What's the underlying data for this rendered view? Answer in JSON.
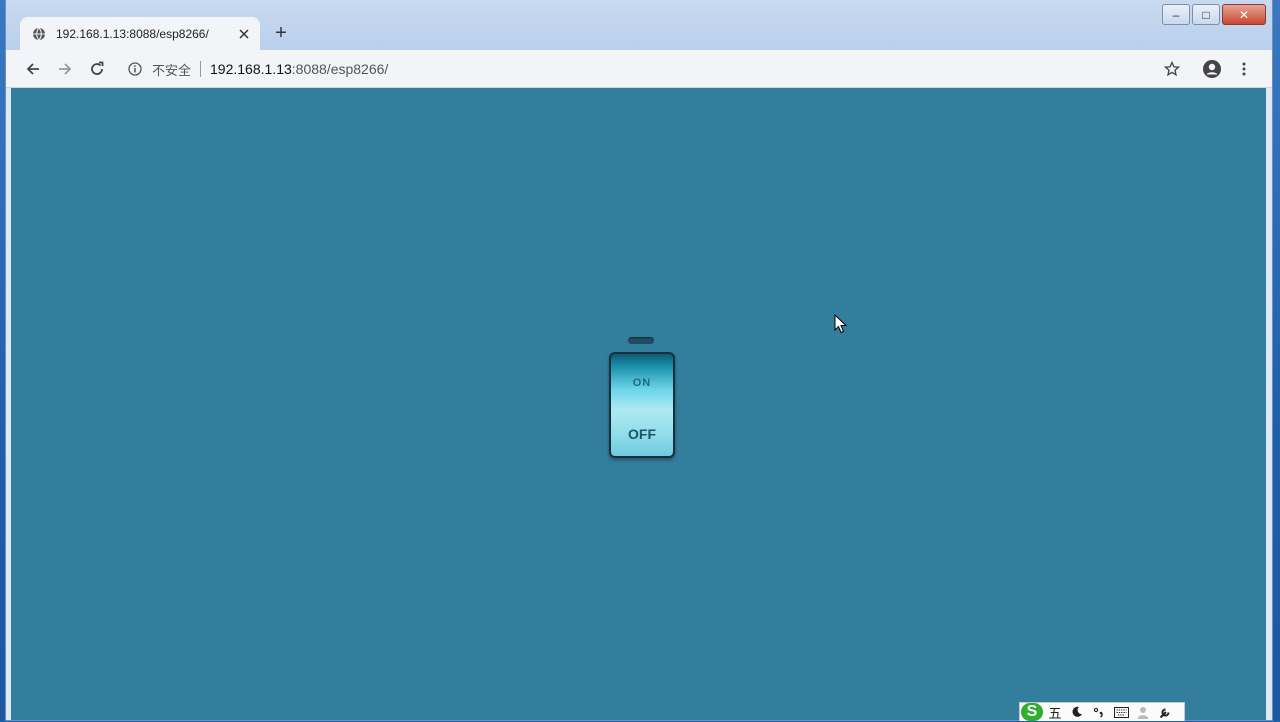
{
  "browser": {
    "tab": {
      "title": "192.168.1.13:8088/esp8266/"
    },
    "new_tab_symbol": "+",
    "window_controls": {
      "minimize": "–",
      "maximize": "□",
      "close": "✕"
    },
    "address_bar": {
      "security_label": "不安全",
      "host": "192.168.1.13",
      "path": ":8088/esp8266/"
    }
  },
  "page": {
    "background_color": "#337e9c",
    "switch": {
      "on_label": "ON",
      "off_label": "OFF",
      "state": "off"
    }
  },
  "ime_toolbar": {
    "logo_label": "S",
    "mode_label": "五"
  }
}
